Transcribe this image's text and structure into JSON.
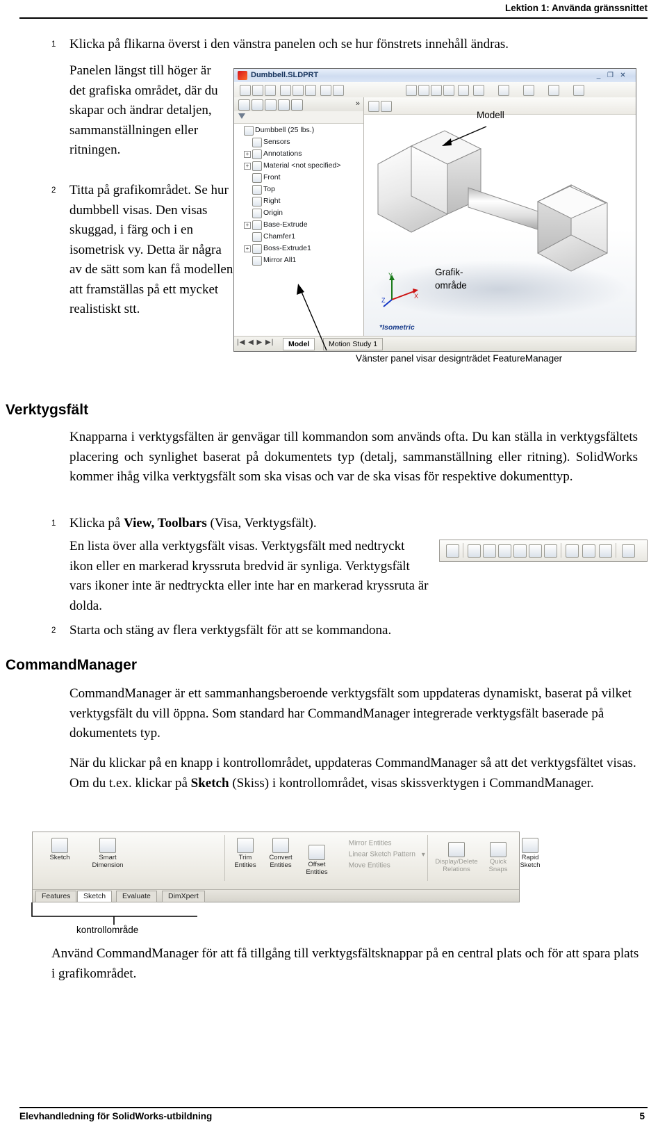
{
  "header": {
    "title": "Lektion 1: Använda gränssnittet"
  },
  "footer": {
    "left": "Elevhandledning för SolidWorks-utbildning",
    "page": "5"
  },
  "steps_top": [
    {
      "num": "1",
      "text": "Klicka på flikarna överst i den vänstra panelen och se hur fönstrets innehåll ändras."
    }
  ],
  "left_column": {
    "lead": "Panelen längst till höger är det grafiska området, där du skapar och ändrar detaljen, sammanställningen eller ritningen.",
    "step2_num": "2",
    "step2_text": "Titta på grafikområdet. Se hur dumbbell visas. Den visas skuggad, i färg och i en isometrisk vy. Detta är några av de sätt som kan få modellen att framställas på ett mycket realistiskt stt."
  },
  "screenshot": {
    "window_title": "Dumbbell.SLDPRT",
    "window_buttons": {
      "minimize": "_",
      "maximize": "❐",
      "close": "✕"
    },
    "tab_more": "»",
    "tree": [
      {
        "label": "Dumbbell (25 lbs.)",
        "icon": "part-icon",
        "expandable": false,
        "indent": 0
      },
      {
        "label": "Sensors",
        "icon": "sensors-icon",
        "expandable": false,
        "indent": 1
      },
      {
        "label": "Annotations",
        "icon": "annotations-icon",
        "expandable": true,
        "indent": 1
      },
      {
        "label": "Material <not specified>",
        "icon": "material-icon",
        "expandable": true,
        "indent": 1
      },
      {
        "label": "Front",
        "icon": "plane-icon",
        "expandable": false,
        "indent": 1
      },
      {
        "label": "Top",
        "icon": "plane-icon",
        "expandable": false,
        "indent": 1
      },
      {
        "label": "Right",
        "icon": "plane-icon",
        "expandable": false,
        "indent": 1
      },
      {
        "label": "Origin",
        "icon": "origin-icon",
        "expandable": false,
        "indent": 1
      },
      {
        "label": "Base-Extrude",
        "icon": "feature-icon",
        "expandable": true,
        "indent": 1
      },
      {
        "label": "Chamfer1",
        "icon": "chamfer-icon",
        "expandable": false,
        "indent": 1
      },
      {
        "label": "Boss-Extrude1",
        "icon": "feature-icon",
        "expandable": true,
        "indent": 1
      },
      {
        "label": "Mirror All1",
        "icon": "mirror-icon",
        "expandable": false,
        "indent": 1
      }
    ],
    "status_tabs": [
      "Model",
      "Motion Study 1"
    ],
    "view_orientation_label": "*Isometric",
    "triad_labels": {
      "x": "X",
      "y": "Y",
      "z": "Z"
    }
  },
  "callouts": {
    "model": "Modell",
    "graphics_area_line1": "Grafik-",
    "graphics_area_line2": "område",
    "featuremanager": "Vänster panel visar designträdet FeatureManager"
  },
  "sections": [
    {
      "heading": "Verktygsfält",
      "paragraphs": [
        "Knapparna i verktygsfälten är genvägar till kommandon som används ofta. Du kan ställa in verktygsfältets placering och synlighet baserat på dokumentets typ (detalj, sammanställning eller ritning). SolidWorks kommer ihåg vilka verktygsfält som ska visas och var de ska visas för respektive dokumenttyp."
      ],
      "steps": [
        {
          "num": "1",
          "text_parts": [
            {
              "t": "Klicka på ",
              "b": false
            },
            {
              "t": "View, Toolbars",
              "b": true
            },
            {
              "t": " (Visa, Verktygsfält).",
              "b": false
            }
          ]
        },
        {
          "num": "2",
          "text_parts": [
            {
              "t": "Starta och stäng av flera verktygsfält för att se kommandona.",
              "b": false
            }
          ]
        }
      ],
      "sub_paragraph": "En lista över alla verktygsfält visas. Verktygsfält med nedtryckt ikon eller en markerad kryssruta bredvid är synliga. Verktygsfält vars ikoner inte är nedtryckta eller inte har en markerad kryssruta är dolda."
    },
    {
      "heading": "CommandManager",
      "paragraphs": [
        "CommandManager är ett sammanhangsberoende verktygsfält som uppdateras dynamiskt, baserat på vilket verktygsfält du vill öppna. Som standard har CommandManager integrerade verktygsfält baserade på dokumentets typ."
      ]
    }
  ],
  "cm_paragraph_parts": [
    {
      "t": "När du klickar på en knapp i kontrollområdet, uppdateras CommandManager så att det verktygsfältet visas. Om du t.ex. klickar på ",
      "b": false
    },
    {
      "t": "Sketch",
      "b": true
    },
    {
      "t": " (Skiss) i kontrollområdet, visas skissverktygen i CommandManager.",
      "b": false
    }
  ],
  "commandmanager_image": {
    "buttons": [
      {
        "label1": "Sketch",
        "label2": ""
      },
      {
        "label1": "Smart",
        "label2": "Dimension"
      },
      {
        "label1": "Trim",
        "label2": "Entities"
      },
      {
        "label1": "Convert",
        "label2": "Entities"
      },
      {
        "label1": "Offset",
        "label2": "Entities"
      },
      {
        "label1": "Display/Delete",
        "label2": "Relations"
      },
      {
        "label1": "Quick",
        "label2": "Snaps"
      },
      {
        "label1": "Rapid",
        "label2": "Sketch"
      }
    ],
    "list_items": [
      "Mirror Entities",
      "Linear Sketch Pattern",
      "Move Entities"
    ],
    "tabs": [
      "Features",
      "Sketch",
      "Evaluate",
      "DimXpert"
    ],
    "selected_tab": "Sketch",
    "annotation": "kontrollområde"
  },
  "closing_paragraph": "Använd CommandManager för att få tillgång till verktygsfältsknappar på en central plats och för att spara plats i grafikområdet."
}
